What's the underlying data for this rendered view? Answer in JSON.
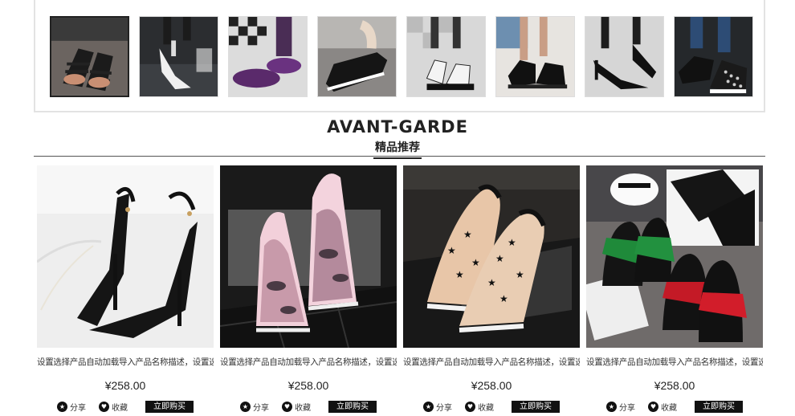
{
  "thumbnails": [
    {
      "alt": "thumb-1"
    },
    {
      "alt": "thumb-2"
    },
    {
      "alt": "thumb-3"
    },
    {
      "alt": "thumb-4"
    },
    {
      "alt": "thumb-5"
    },
    {
      "alt": "thumb-6"
    },
    {
      "alt": "thumb-7"
    },
    {
      "alt": "thumb-8"
    }
  ],
  "section": {
    "title_en": "AVANT-GARDE",
    "title_cn": "精品推荐"
  },
  "products": [
    {
      "name": "设置选择产品自动加载导入产品名称描述，设置选择",
      "price": "¥258.00",
      "share": "分享",
      "favorite": "收藏",
      "buy": "立即购买"
    },
    {
      "name": "设置选择产品自动加载导入产品名称描述，设置选择",
      "price": "¥258.00",
      "share": "分享",
      "favorite": "收藏",
      "buy": "立即购买"
    },
    {
      "name": "设置选择产品自动加载导入产品名称描述，设置选择",
      "price": "¥258.00",
      "share": "分享",
      "favorite": "收藏",
      "buy": "立即购买"
    },
    {
      "name": "设置选择产品自动加载导入产品名称描述，设置选择",
      "price": "¥258.00",
      "share": "分享",
      "favorite": "收藏",
      "buy": "立即购买"
    }
  ],
  "icons": {
    "share": "star-icon",
    "favorite": "heart-icon"
  }
}
